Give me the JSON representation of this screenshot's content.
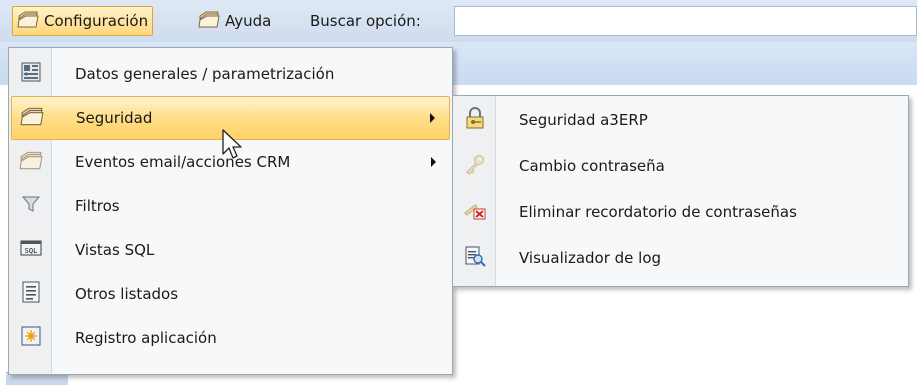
{
  "menubar": {
    "items": [
      {
        "label": "Configuración",
        "icon": "folder-stack-icon",
        "active": true
      },
      {
        "label": "Ayuda",
        "icon": "folder-stack-icon",
        "active": false
      }
    ],
    "search_label": "Buscar opción:",
    "search_value": ""
  },
  "main_menu": {
    "items": [
      {
        "label": "Datos generales / parametrización",
        "icon": "settings-grid-icon",
        "submenu": false
      },
      {
        "label": "Seguridad",
        "icon": "folder-stack-icon",
        "submenu": true,
        "highlighted": true
      },
      {
        "label": "Eventos email/acciones CRM",
        "icon": "folder-stack-icon",
        "submenu": true
      },
      {
        "label": "Filtros",
        "icon": "funnel-icon",
        "submenu": false
      },
      {
        "label": "Vistas SQL",
        "icon": "sql-icon",
        "submenu": false
      },
      {
        "label": "Otros listados",
        "icon": "document-list-icon",
        "submenu": false
      },
      {
        "label": "Registro aplicación",
        "icon": "registration-icon",
        "submenu": false
      }
    ]
  },
  "sub_menu": {
    "items": [
      {
        "label": "Seguridad a3ERP",
        "icon": "padlock-key-icon"
      },
      {
        "label": "Cambio contraseña",
        "icon": "key-icon"
      },
      {
        "label": "Eliminar recordatorio de contraseñas",
        "icon": "delete-reminder-icon"
      },
      {
        "label": "Visualizador de log",
        "icon": "log-viewer-icon"
      }
    ]
  },
  "colors": {
    "highlight_top": "#fff3cd",
    "highlight_bottom": "#ffd26a",
    "menubar_bg": "#dfe9f5",
    "menu_bg": "#f7f8f9"
  }
}
